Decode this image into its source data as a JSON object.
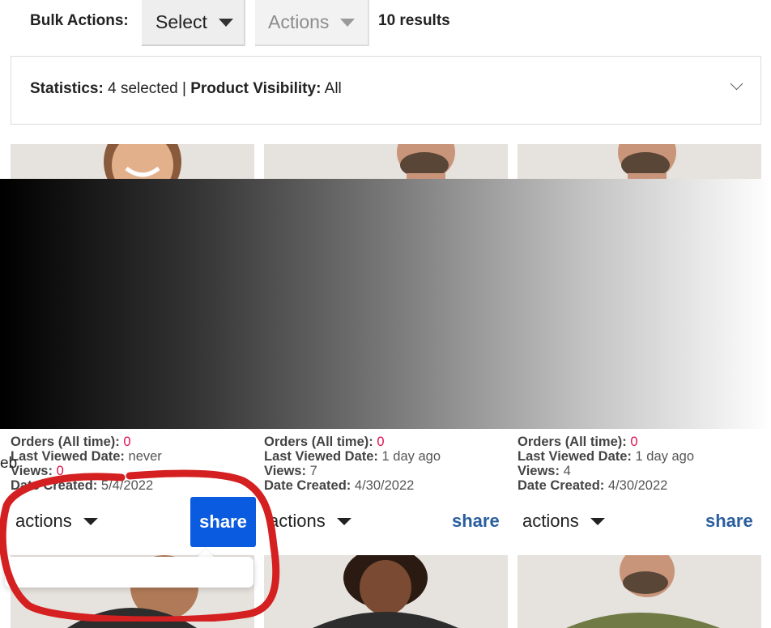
{
  "toolbar": {
    "bulk_label": "Bulk Actions:",
    "select_label": "Select",
    "actions_label": "Actions",
    "results_text": "10 results"
  },
  "stats": {
    "statistics_label": "Statistics:",
    "statistics_value": "4 selected",
    "separator": "|",
    "visibility_label": "Product Visibility:",
    "visibility_value": "All"
  },
  "stray_text": "eb",
  "cards": [
    {
      "orders_label": "Orders (All time):",
      "orders": "0",
      "last_viewed_label": "Last Viewed Date:",
      "last_viewed": "never",
      "views_label": "Views:",
      "views": "0",
      "created_label": "Date Created:",
      "created": "5/4/2022",
      "actions_label": "actions",
      "share_label": "share"
    },
    {
      "orders_label": "Orders (All time):",
      "orders": "0",
      "last_viewed_label": "Last Viewed Date:",
      "last_viewed": "1 day ago",
      "views_label": "Views:",
      "views": "7",
      "created_label": "Date Created:",
      "created": "4/30/2022",
      "actions_label": "actions",
      "share_label": "share"
    },
    {
      "orders_label": "Orders (All time):",
      "orders": "0",
      "last_viewed_label": "Last Viewed Date:",
      "last_viewed": "1 day ago",
      "views_label": "Views:",
      "views": "4",
      "created_label": "Date Created:",
      "created": "4/30/2022",
      "actions_label": "actions",
      "share_label": "share"
    }
  ],
  "colors": {
    "accent_blue": "#0b5be0",
    "link_blue": "#2a5e9e",
    "count_pink": "#e0114e",
    "annotation_red": "#d42020"
  }
}
